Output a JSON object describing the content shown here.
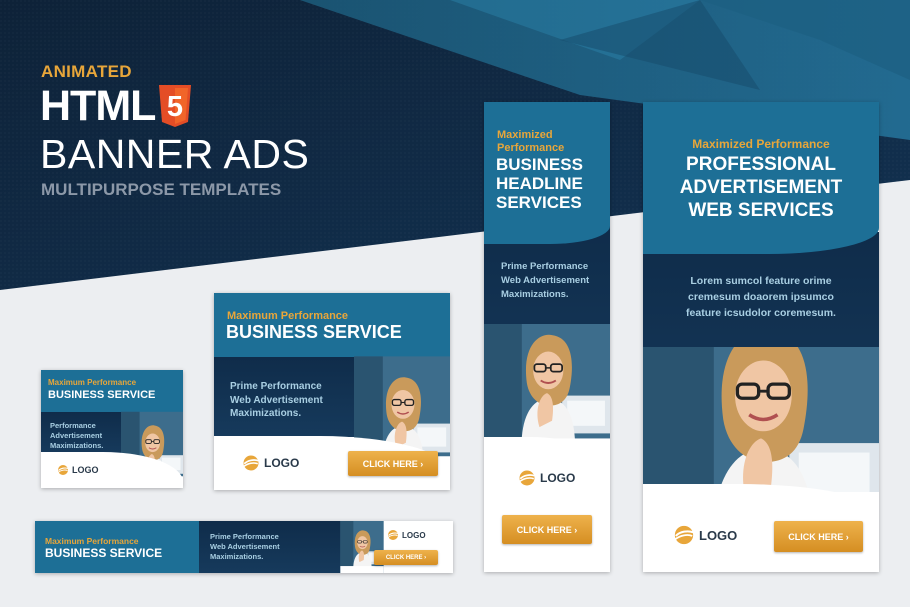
{
  "hero": {
    "animated": "ANIMATED",
    "html": "HTML",
    "html_version": "5",
    "banner_ads": "BANNER ADS",
    "subtitle": "MULTIPURPOSE TEMPLATES"
  },
  "ad_small": {
    "kicker": "Maximum Performance",
    "headline": "BUSINESS SERVICE",
    "body_lines": [
      "Performance",
      "Advertisement",
      "Maximizations."
    ],
    "logo": "LOGO"
  },
  "ad_medium": {
    "kicker": "Maximum Performance",
    "headline": "BUSINESS SERVICE",
    "body_lines": [
      "Prime Performance",
      "Web Advertisement",
      "Maximizations."
    ],
    "logo": "LOGO",
    "cta": "CLICK HERE ›"
  },
  "ad_leaderboard": {
    "kicker": "Maximum Performance",
    "headline": "BUSINESS SERVICE",
    "body_lines": [
      "Prime Performance",
      "Web Advertisement",
      "Maximizations."
    ],
    "logo": "LOGO",
    "cta": "CLICK HERE ›"
  },
  "ad_skyscraper": {
    "kicker_lines": [
      "Maximized",
      "Performance"
    ],
    "headline_lines": [
      "BUSINESS",
      "HEADLINE",
      "SERVICES"
    ],
    "body_lines": [
      "Prime Performance",
      "Web Advertisement",
      "Maximizations."
    ],
    "logo": "LOGO",
    "cta": "CLICK HERE ›"
  },
  "ad_wide": {
    "kicker": "Maximized Performance",
    "headline_lines": [
      "PROFESSIONAL",
      "ADVERTISEMENT",
      "WEB SERVICES"
    ],
    "body_lines": [
      "Lorem sumcol feature orime",
      "cremesum doaorem ipsumco",
      "feature icsudolor coremesum."
    ],
    "logo": "LOGO",
    "cta": "CLICK HERE ›"
  },
  "colors": {
    "navy": "#122d4a",
    "teal_blue": "#1d6f96",
    "orange": "#e8a63a"
  },
  "icons": [
    "html5-shield-icon",
    "swoosh-globe-logo-icon",
    "chevron-right-icon"
  ]
}
